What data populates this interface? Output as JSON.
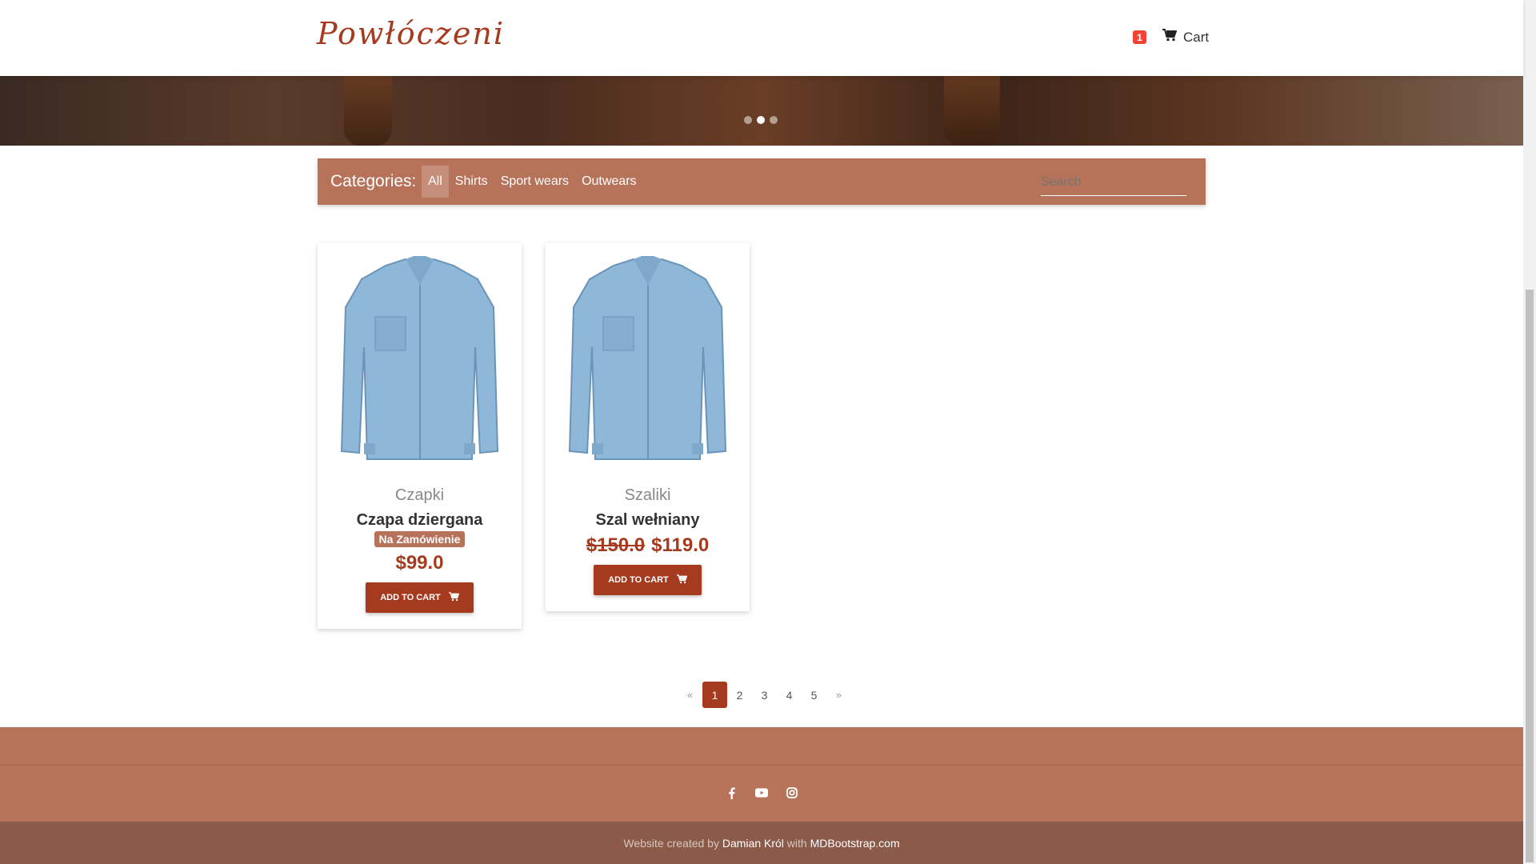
{
  "brand": "Powłóczeni",
  "cart": {
    "count": "1",
    "label": "Cart",
    "icon": "cart-icon"
  },
  "carousel": {
    "slides": 3,
    "active_index": 1
  },
  "categories": {
    "title": "Categories:",
    "items": [
      {
        "label": "All",
        "active": true
      },
      {
        "label": "Shirts",
        "active": false
      },
      {
        "label": "Sport wears",
        "active": false
      },
      {
        "label": "Outwears",
        "active": false
      }
    ],
    "search_placeholder": "Search"
  },
  "products": [
    {
      "category": "Czapki",
      "title": "Czapa dziergana",
      "badge": "Na Zamówienie",
      "price": "$99.0",
      "old_price": "",
      "button": "ADD TO CART"
    },
    {
      "category": "Szaliki",
      "title": "Szal wełniany",
      "badge": "",
      "price": "$119.0",
      "old_price": "$150.0",
      "button": "ADD TO CART"
    }
  ],
  "pagination": {
    "prev": "«",
    "pages": [
      "1",
      "2",
      "3",
      "4",
      "5"
    ],
    "active": "1",
    "next": "»"
  },
  "footer": {
    "social": [
      "facebook-icon",
      "youtube-icon",
      "instagram-icon"
    ],
    "copyright_prefix": "Website created by",
    "author": "Damian Król",
    "with": "with",
    "site": "MDBootstrap.com"
  },
  "colors": {
    "accent": "#a63a1e",
    "bar": "#b7725a",
    "footer_bottom": "#8c5a48"
  }
}
